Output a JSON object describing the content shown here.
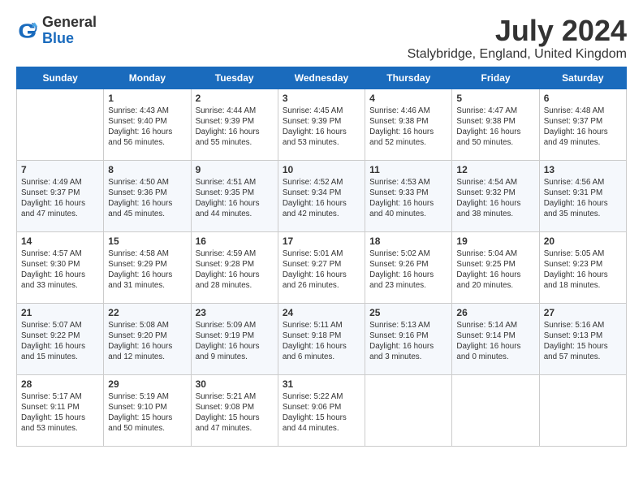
{
  "logo": {
    "general": "General",
    "blue": "Blue"
  },
  "header": {
    "month_year": "July 2024",
    "location": "Stalybridge, England, United Kingdom"
  },
  "weekdays": [
    "Sunday",
    "Monday",
    "Tuesday",
    "Wednesday",
    "Thursday",
    "Friday",
    "Saturday"
  ],
  "weeks": [
    [
      {
        "day": "",
        "sunrise": "",
        "sunset": "",
        "daylight": ""
      },
      {
        "day": "1",
        "sunrise": "Sunrise: 4:43 AM",
        "sunset": "Sunset: 9:40 PM",
        "daylight": "Daylight: 16 hours and 56 minutes."
      },
      {
        "day": "2",
        "sunrise": "Sunrise: 4:44 AM",
        "sunset": "Sunset: 9:39 PM",
        "daylight": "Daylight: 16 hours and 55 minutes."
      },
      {
        "day": "3",
        "sunrise": "Sunrise: 4:45 AM",
        "sunset": "Sunset: 9:39 PM",
        "daylight": "Daylight: 16 hours and 53 minutes."
      },
      {
        "day": "4",
        "sunrise": "Sunrise: 4:46 AM",
        "sunset": "Sunset: 9:38 PM",
        "daylight": "Daylight: 16 hours and 52 minutes."
      },
      {
        "day": "5",
        "sunrise": "Sunrise: 4:47 AM",
        "sunset": "Sunset: 9:38 PM",
        "daylight": "Daylight: 16 hours and 50 minutes."
      },
      {
        "day": "6",
        "sunrise": "Sunrise: 4:48 AM",
        "sunset": "Sunset: 9:37 PM",
        "daylight": "Daylight: 16 hours and 49 minutes."
      }
    ],
    [
      {
        "day": "7",
        "sunrise": "Sunrise: 4:49 AM",
        "sunset": "Sunset: 9:37 PM",
        "daylight": "Daylight: 16 hours and 47 minutes."
      },
      {
        "day": "8",
        "sunrise": "Sunrise: 4:50 AM",
        "sunset": "Sunset: 9:36 PM",
        "daylight": "Daylight: 16 hours and 45 minutes."
      },
      {
        "day": "9",
        "sunrise": "Sunrise: 4:51 AM",
        "sunset": "Sunset: 9:35 PM",
        "daylight": "Daylight: 16 hours and 44 minutes."
      },
      {
        "day": "10",
        "sunrise": "Sunrise: 4:52 AM",
        "sunset": "Sunset: 9:34 PM",
        "daylight": "Daylight: 16 hours and 42 minutes."
      },
      {
        "day": "11",
        "sunrise": "Sunrise: 4:53 AM",
        "sunset": "Sunset: 9:33 PM",
        "daylight": "Daylight: 16 hours and 40 minutes."
      },
      {
        "day": "12",
        "sunrise": "Sunrise: 4:54 AM",
        "sunset": "Sunset: 9:32 PM",
        "daylight": "Daylight: 16 hours and 38 minutes."
      },
      {
        "day": "13",
        "sunrise": "Sunrise: 4:56 AM",
        "sunset": "Sunset: 9:31 PM",
        "daylight": "Daylight: 16 hours and 35 minutes."
      }
    ],
    [
      {
        "day": "14",
        "sunrise": "Sunrise: 4:57 AM",
        "sunset": "Sunset: 9:30 PM",
        "daylight": "Daylight: 16 hours and 33 minutes."
      },
      {
        "day": "15",
        "sunrise": "Sunrise: 4:58 AM",
        "sunset": "Sunset: 9:29 PM",
        "daylight": "Daylight: 16 hours and 31 minutes."
      },
      {
        "day": "16",
        "sunrise": "Sunrise: 4:59 AM",
        "sunset": "Sunset: 9:28 PM",
        "daylight": "Daylight: 16 hours and 28 minutes."
      },
      {
        "day": "17",
        "sunrise": "Sunrise: 5:01 AM",
        "sunset": "Sunset: 9:27 PM",
        "daylight": "Daylight: 16 hours and 26 minutes."
      },
      {
        "day": "18",
        "sunrise": "Sunrise: 5:02 AM",
        "sunset": "Sunset: 9:26 PM",
        "daylight": "Daylight: 16 hours and 23 minutes."
      },
      {
        "day": "19",
        "sunrise": "Sunrise: 5:04 AM",
        "sunset": "Sunset: 9:25 PM",
        "daylight": "Daylight: 16 hours and 20 minutes."
      },
      {
        "day": "20",
        "sunrise": "Sunrise: 5:05 AM",
        "sunset": "Sunset: 9:23 PM",
        "daylight": "Daylight: 16 hours and 18 minutes."
      }
    ],
    [
      {
        "day": "21",
        "sunrise": "Sunrise: 5:07 AM",
        "sunset": "Sunset: 9:22 PM",
        "daylight": "Daylight: 16 hours and 15 minutes."
      },
      {
        "day": "22",
        "sunrise": "Sunrise: 5:08 AM",
        "sunset": "Sunset: 9:20 PM",
        "daylight": "Daylight: 16 hours and 12 minutes."
      },
      {
        "day": "23",
        "sunrise": "Sunrise: 5:09 AM",
        "sunset": "Sunset: 9:19 PM",
        "daylight": "Daylight: 16 hours and 9 minutes."
      },
      {
        "day": "24",
        "sunrise": "Sunrise: 5:11 AM",
        "sunset": "Sunset: 9:18 PM",
        "daylight": "Daylight: 16 hours and 6 minutes."
      },
      {
        "day": "25",
        "sunrise": "Sunrise: 5:13 AM",
        "sunset": "Sunset: 9:16 PM",
        "daylight": "Daylight: 16 hours and 3 minutes."
      },
      {
        "day": "26",
        "sunrise": "Sunrise: 5:14 AM",
        "sunset": "Sunset: 9:14 PM",
        "daylight": "Daylight: 16 hours and 0 minutes."
      },
      {
        "day": "27",
        "sunrise": "Sunrise: 5:16 AM",
        "sunset": "Sunset: 9:13 PM",
        "daylight": "Daylight: 15 hours and 57 minutes."
      }
    ],
    [
      {
        "day": "28",
        "sunrise": "Sunrise: 5:17 AM",
        "sunset": "Sunset: 9:11 PM",
        "daylight": "Daylight: 15 hours and 53 minutes."
      },
      {
        "day": "29",
        "sunrise": "Sunrise: 5:19 AM",
        "sunset": "Sunset: 9:10 PM",
        "daylight": "Daylight: 15 hours and 50 minutes."
      },
      {
        "day": "30",
        "sunrise": "Sunrise: 5:21 AM",
        "sunset": "Sunset: 9:08 PM",
        "daylight": "Daylight: 15 hours and 47 minutes."
      },
      {
        "day": "31",
        "sunrise": "Sunrise: 5:22 AM",
        "sunset": "Sunset: 9:06 PM",
        "daylight": "Daylight: 15 hours and 44 minutes."
      },
      {
        "day": "",
        "sunrise": "",
        "sunset": "",
        "daylight": ""
      },
      {
        "day": "",
        "sunrise": "",
        "sunset": "",
        "daylight": ""
      },
      {
        "day": "",
        "sunrise": "",
        "sunset": "",
        "daylight": ""
      }
    ]
  ]
}
